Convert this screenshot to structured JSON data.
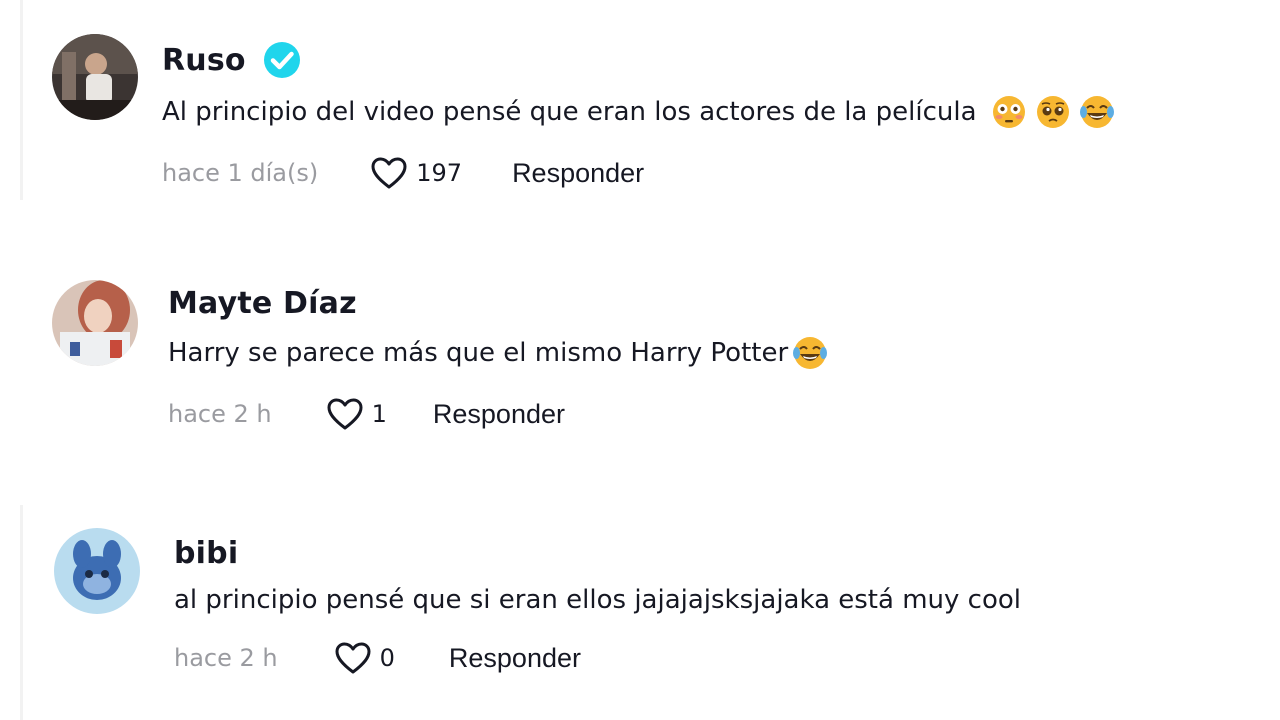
{
  "comments": [
    {
      "username": "Ruso",
      "verified": true,
      "text": "Al principio del video pensé que eran los actores de la película",
      "emojis": [
        "flushed-face",
        "pleading-face",
        "face-with-tears-of-joy"
      ],
      "time": "hace 1 día(s)",
      "likes": "197",
      "reply_label": "Responder"
    },
    {
      "username": "Mayte Díaz",
      "verified": false,
      "text": "Harry se parece más que el mismo Harry Potter",
      "emojis": [
        "face-with-tears-of-joy"
      ],
      "time": "hace 2 h",
      "likes": "1",
      "reply_label": "Responder"
    },
    {
      "username": "bibi",
      "verified": false,
      "text": "al principio pensé que si eran ellos jajajajsksjajaka está muy cool",
      "emojis": [],
      "time": "hace 2 h",
      "likes": "0",
      "reply_label": "Responder"
    }
  ],
  "colors": {
    "verified_badge": "#20d5ec",
    "time_text": "#9a9ba0",
    "primary_text": "#161823"
  },
  "icons": {
    "like": "heart-outline-icon",
    "verified": "verified-check-icon"
  }
}
